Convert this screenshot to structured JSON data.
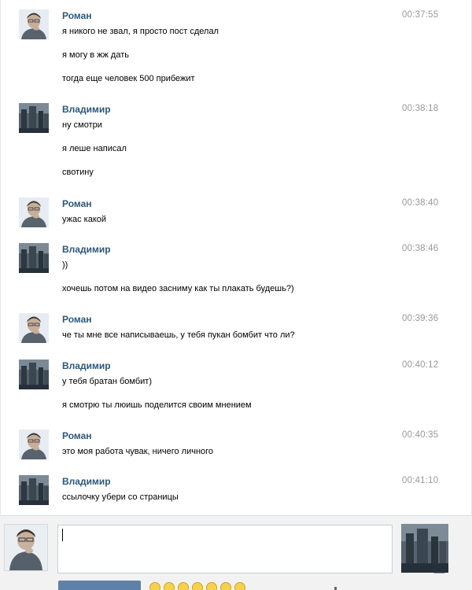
{
  "messages": [
    {
      "author": "Роман",
      "time": "00:37:55",
      "avatar": "roman",
      "lines": [
        "я никого не звал, я просто пост сделал",
        "я могу в жж дать",
        "тогда еще человек 500 прибежит"
      ]
    },
    {
      "author": "Владимир",
      "time": "00:38:18",
      "avatar": "vladimir",
      "lines": [
        "ну смотри",
        "я леше написал",
        "свотину"
      ]
    },
    {
      "author": "Роман",
      "time": "00:38:40",
      "avatar": "roman",
      "lines": [
        "ужас какой"
      ]
    },
    {
      "author": "Владимир",
      "time": "00:38:46",
      "avatar": "vladimir",
      "lines": [
        "))",
        "хочешь потом на видео засниму как ты плакать будешь?)"
      ]
    },
    {
      "author": "Роман",
      "time": "00:39:36",
      "avatar": "roman",
      "lines": [
        "че ты мне все написываешь, у тебя пукан бомбит что ли?"
      ]
    },
    {
      "author": "Владимир",
      "time": "00:40:12",
      "avatar": "vladimir",
      "lines": [
        "у тебя братан бомбит)",
        "я смотрю ты люишь поделится своим мнением"
      ]
    },
    {
      "author": "Роман",
      "time": "00:40:35",
      "avatar": "roman",
      "lines": [
        "это моя работа чувак, ничего личного"
      ]
    },
    {
      "author": "Владимир",
      "time": "00:41:10",
      "avatar": "vladimir",
      "lines": [
        "ссылочку убери со страницы"
      ]
    }
  ],
  "composer": {
    "input_value": "",
    "send_label": "",
    "icons": [
      "smile-icon",
      "camera-icon"
    ]
  },
  "colors": {
    "author": "#2b587a",
    "time": "#999999",
    "send_button": "#5e81a8",
    "composer_bg": "#f2f2f2"
  }
}
